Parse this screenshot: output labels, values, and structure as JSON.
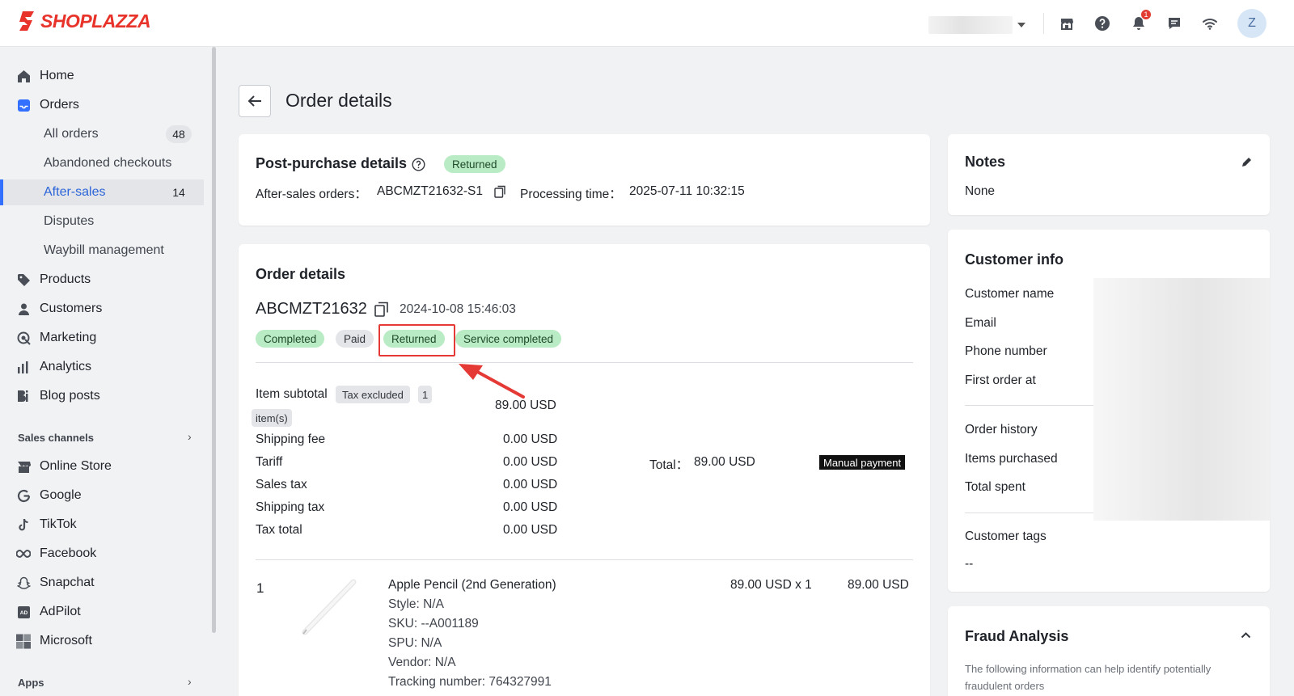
{
  "brand": {
    "name": "SHOPLAZZA",
    "color": "#e8332a"
  },
  "topbar": {
    "icons": [
      "store-icon",
      "help-icon",
      "bell-icon",
      "chat-icon",
      "wifi-icon"
    ],
    "notification_count": "1",
    "avatar_initial": "Z"
  },
  "sidebar": {
    "items": {
      "home": "Home",
      "orders": "Orders",
      "all_orders": "All orders",
      "all_orders_count": "48",
      "abandoned": "Abandoned checkouts",
      "after_sales": "After-sales",
      "after_sales_count": "14",
      "disputes": "Disputes",
      "waybill": "Waybill management",
      "products": "Products",
      "customers": "Customers",
      "marketing": "Marketing",
      "analytics": "Analytics",
      "blog": "Blog posts"
    },
    "sales_channels_title": "Sales channels",
    "channels": {
      "online_store": "Online Store",
      "google": "Google",
      "tiktok": "TikTok",
      "facebook": "Facebook",
      "snapchat": "Snapchat",
      "adpilot": "AdPilot",
      "microsoft": "Microsoft"
    },
    "apps_title": "Apps"
  },
  "page": {
    "title": "Order details"
  },
  "post_purchase": {
    "title": "Post-purchase details",
    "status": "Returned",
    "after_sales_label": "After-sales orders：",
    "after_sales_value": "ABCMZT21632-S1",
    "processing_label": "Processing time：",
    "processing_value": "2025-07-11 10:32:15"
  },
  "order": {
    "title": "Order details",
    "number": "ABCMZT21632",
    "date": "2024-10-08 15:46:03",
    "tags": {
      "completed": "Completed",
      "paid": "Paid",
      "returned": "Returned",
      "service_completed": "Service completed"
    },
    "summary": {
      "item_subtotal_label": "Item subtotal",
      "tax_excluded": "Tax excluded",
      "items_count": "1",
      "items_unit": "item(s)",
      "item_subtotal_value": "89.00 USD",
      "shipping_fee_label": "Shipping fee",
      "shipping_fee_value": "0.00 USD",
      "tariff_label": "Tariff",
      "tariff_value": "0.00 USD",
      "sales_tax_label": "Sales tax",
      "sales_tax_value": "0.00 USD",
      "shipping_tax_label": "Shipping tax",
      "shipping_tax_value": "0.00 USD",
      "tax_total_label": "Tax total",
      "tax_total_value": "0.00 USD",
      "total_label": "Total：",
      "total_value": "89.00 USD",
      "payment_method": "Manual payment"
    },
    "line_item": {
      "index": "1",
      "name": "Apple Pencil (2nd Generation)",
      "style": "Style: N/A",
      "sku": "SKU: --A001189",
      "spu": "SPU: N/A",
      "vendor": "Vendor: N/A",
      "tracking": "Tracking number: 764327991",
      "unit_price": "89.00 USD x 1",
      "line_total": "89.00 USD"
    }
  },
  "notes": {
    "title": "Notes",
    "value": "None"
  },
  "customer_info": {
    "title": "Customer info",
    "name_label": "Customer name",
    "email_label": "Email",
    "phone_label": "Phone number",
    "first_order_label": "First order at",
    "order_history_label": "Order history",
    "items_purchased_label": "Items purchased",
    "total_spent_label": "Total spent",
    "tags_label": "Customer tags",
    "tags_value": "--"
  },
  "fraud": {
    "title": "Fraud Analysis",
    "description": "The following information can help identify potentially fraudulent orders"
  },
  "annotation": {
    "highlight_color": "#e53935"
  }
}
